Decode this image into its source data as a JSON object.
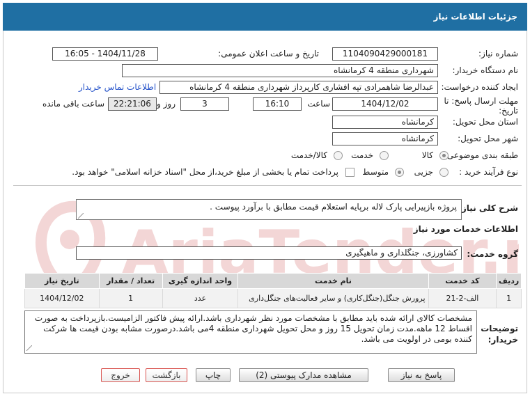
{
  "header": {
    "title": "جزئیات اطلاعات نیاز"
  },
  "labels": {
    "need_number": "شماره نیاز:",
    "announce_datetime": "تاریخ و ساعت اعلان عمومی:",
    "buyer_org": "نام دستگاه خریدار:",
    "creator": "ایجاد کننده درخواست:",
    "buyer_contact": "اطلاعات تماس خریدار",
    "deadline": "مهلت ارسال پاسخ: تا تاریخ:",
    "time_word": "ساعت",
    "day_and": "روز و",
    "remaining": "ساعت باقی مانده",
    "province": "استان محل تحویل:",
    "city": "شهر محل تحویل:",
    "category": "طبقه بندی موضوعی:",
    "process_type": "نوع فرآیند خرید :",
    "need_desc": "شرح کلی نیاز:",
    "services_title": "اطلاعات خدمات مورد نیاز",
    "service_group": "گروه خدمت:",
    "buyer_notes": "توضیحات خریدار:"
  },
  "fields": {
    "need_number": "1104090429000181",
    "announce_datetime": "1404/11/28 - 16:05",
    "buyer_org": "شهرداری منطقه 4 کرمانشاه",
    "creator": "عبدالرضا شاهمرادی تپه افشاری کارپرداز شهرداری منطقه 4 کرمانشاه",
    "deadline_date": "1404/12/02",
    "deadline_time": "16:10",
    "days": "3",
    "remaining_time": "22:21:06",
    "province": "کرمانشاه",
    "city": "کرمانشاه",
    "need_desc": "پروژه بازپیرایی پارک لاله برپایه استعلام قیمت مطابق با برآورد پیوست .",
    "service_group": "کشاورزی، جنگلداری و ماهیگیری",
    "buyer_notes": "مشخصات کالای ارائه شده باید مطابق با مشخصات مورد نظر شهرداری باشد.ارائه پیش فاکتور الزامیست.بازپرداخت به صورت اقساط 12 ماهه.مدت زمان تحویل 15 روز و محل تحویل شهرداری منطقه 4می باشد.درصورت مشابه بودن قیمت ها شرکت کننده بومی در اولویت می باشد."
  },
  "category_options": [
    "کالا",
    "خدمت",
    "کالا/خدمت"
  ],
  "process_options": [
    "جزیی",
    "متوسط"
  ],
  "payment_note": "پرداخت تمام یا بخشی از مبلغ خرید،از محل \"اسناد خزانه اسلامی\" خواهد بود.",
  "table": {
    "headers": [
      "ردیف",
      "کد خدمت",
      "نام خدمت",
      "واحد اندازه گیری",
      "تعداد / مقدار",
      "تاریخ نیاز"
    ],
    "rows": [
      [
        "1",
        "الف-2-21",
        "پرورش جنگل(جنگل‌کاری) و سایر فعالیت‌های جنگل‌داری",
        "عدد",
        "1",
        "1404/12/02"
      ]
    ]
  },
  "buttons": {
    "reply": "پاسخ به نیاز",
    "attachments": "مشاهده مدارک پیوستی (2)",
    "print": "چاپ",
    "back": "بازگشت",
    "exit": "خروج"
  },
  "watermark_text": "AriaTender.net",
  "colors": {
    "header_bg": "#1f6fa3",
    "link": "#2351c9",
    "watermark": "#f3d6d6"
  }
}
